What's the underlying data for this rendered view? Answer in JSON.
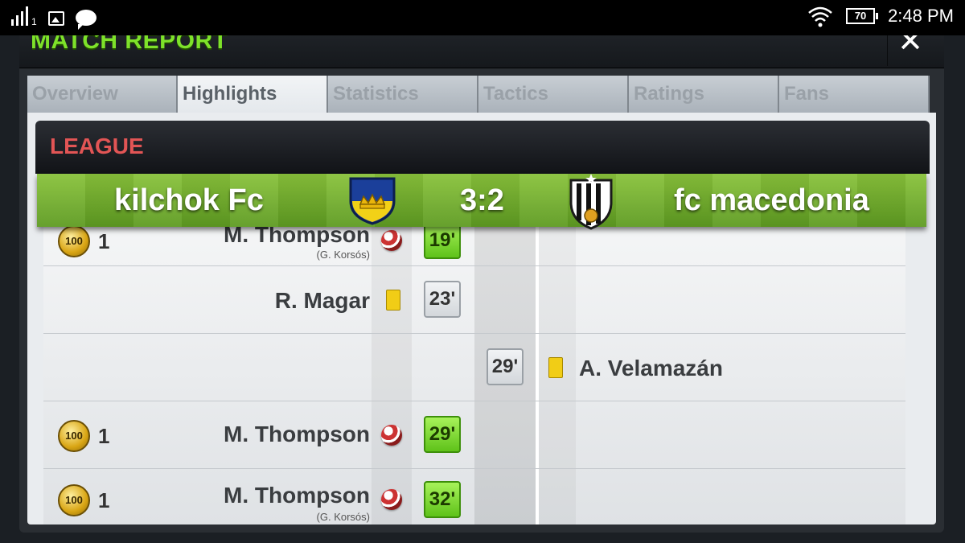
{
  "status_bar": {
    "sim_label": "1",
    "battery": "70",
    "time": "2:48 PM"
  },
  "report": {
    "title": "MATCH REPORT",
    "close_glyph": "✕"
  },
  "tabs": [
    {
      "label": "Overview",
      "active": false
    },
    {
      "label": "Highlights",
      "active": true
    },
    {
      "label": "Statistics",
      "active": false
    },
    {
      "label": "Tactics",
      "active": false
    },
    {
      "label": "Ratings",
      "active": false
    },
    {
      "label": "Fans",
      "active": false
    }
  ],
  "match": {
    "competition": "LEAGUE",
    "home_team": "kilchok Fc",
    "away_team": "fc macedonia",
    "score": "3:2"
  },
  "highlights": [
    {
      "side": "home",
      "type": "goal",
      "coin": "100",
      "coin_value": "1",
      "player": "M. Thompson",
      "assist": "(G. Korsós)",
      "minute": "19'"
    },
    {
      "side": "home",
      "type": "yellow",
      "player": "R. Magar",
      "minute": "23'"
    },
    {
      "side": "away",
      "type": "yellow",
      "player": "A. Velamazán",
      "minute": "29'"
    },
    {
      "side": "home",
      "type": "goal",
      "coin": "100",
      "coin_value": "1",
      "player": "M. Thompson",
      "minute": "29'"
    },
    {
      "side": "home",
      "type": "goal",
      "coin": "100",
      "coin_value": "1",
      "player": "M. Thompson",
      "assist": "(G. Korsós)",
      "minute": "32'"
    }
  ],
  "colors": {
    "title_green": "#7ee22a",
    "league_red": "#e25555",
    "goal_minute": "#6cd11f",
    "yellow_card": "#f1cd16"
  }
}
